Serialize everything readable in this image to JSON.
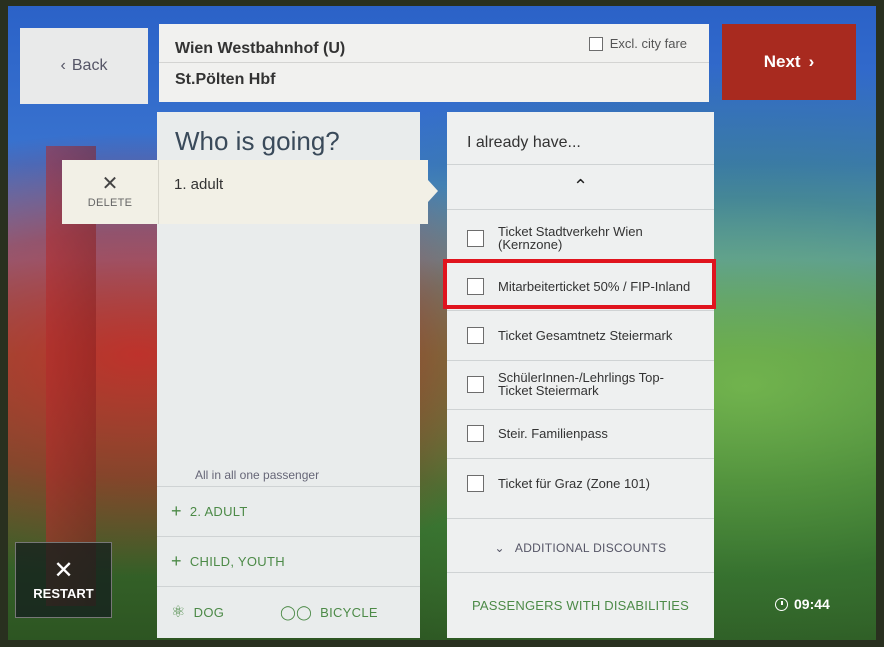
{
  "header": {
    "back_label": "Back",
    "from_station": "Wien Westbahnhof (U)",
    "to_station": "St.Pölten Hbf",
    "excl_city_fare_label": "Excl. city fare",
    "next_label": "Next"
  },
  "who": {
    "title": "Who is going?",
    "passengers": [
      {
        "label": "1. adult",
        "delete_label": "DELETE"
      }
    ],
    "summary": "All in all one passenger",
    "add_rows": [
      {
        "label": "2. ADULT"
      },
      {
        "label": "CHILD, YOUTH"
      }
    ],
    "dog_label": "DOG",
    "bicycle_label": "BICYCLE"
  },
  "have": {
    "title": "I already have...",
    "options": [
      {
        "label": "Ticket Stadtverkehr Wien (Kernzone)",
        "checked": false
      },
      {
        "label": "Mitarbeiterticket 50% / FIP-Inland",
        "checked": false
      },
      {
        "label": "Ticket Gesamtnetz Steiermark",
        "checked": false
      },
      {
        "label": "SchülerInnen-/Lehrlings Top-Ticket Steiermark",
        "checked": false
      },
      {
        "label": "Steir. Familienpass",
        "checked": false
      },
      {
        "label": "Ticket für Graz (Zone 101)",
        "checked": false
      }
    ],
    "additional_discounts_label": "ADDITIONAL DISCOUNTS",
    "disabilities_label": "PASSENGERS WITH DISABILITIES"
  },
  "footer": {
    "restart_label": "RESTART",
    "time": "09:44"
  },
  "colors": {
    "accent_red": "#a82a1f",
    "highlight": "#e0141e",
    "action_green": "#4c8a47"
  }
}
